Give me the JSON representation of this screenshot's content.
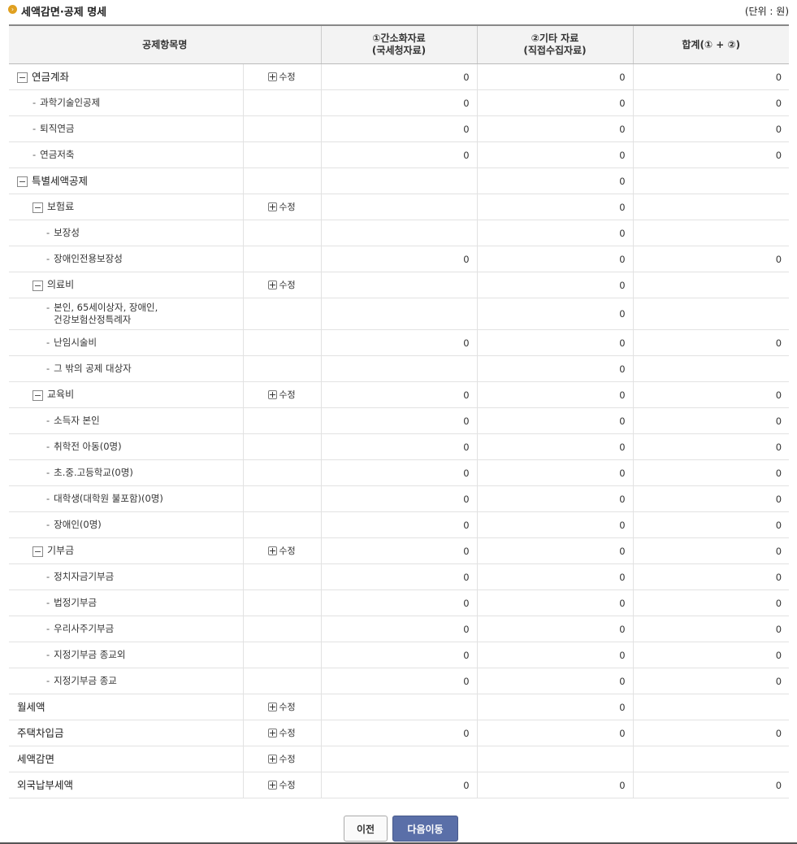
{
  "header": {
    "title": "세액감면·공제 명세",
    "unit": "(단위 : 원)"
  },
  "columns": {
    "item": "공제항목명",
    "col1": "①간소화자료\n(국세청자료)",
    "col2": "②기타 자료\n(직접수집자료)",
    "total": "합계(① + ②)"
  },
  "edit_label": "수정",
  "rows": [
    {
      "label": "연금계좌",
      "level": 0,
      "box": true,
      "edit": true,
      "c1": "0",
      "c2": "0",
      "t": "0"
    },
    {
      "label": "과학기술인공제",
      "level": 1,
      "box": false,
      "edit": false,
      "c1": "0",
      "c2": "0",
      "t": "0"
    },
    {
      "label": "퇴직연금",
      "level": 1,
      "box": false,
      "edit": false,
      "c1": "0",
      "c2": "0",
      "t": "0"
    },
    {
      "label": "연금저축",
      "level": 1,
      "box": false,
      "edit": false,
      "c1": "0",
      "c2": "0",
      "t": "0"
    },
    {
      "label": "특별세액공제",
      "level": 0,
      "box": true,
      "edit": false,
      "c1": "",
      "c2": "0",
      "t": ""
    },
    {
      "label": "보험료",
      "level": 1,
      "box": true,
      "edit": true,
      "c1": "",
      "c2": "0",
      "t": ""
    },
    {
      "label": "보장성",
      "level": 2,
      "box": false,
      "edit": false,
      "c1": "",
      "c2": "0",
      "t": ""
    },
    {
      "label": "장애인전용보장성",
      "level": 2,
      "box": false,
      "edit": false,
      "c1": "0",
      "c2": "0",
      "t": "0"
    },
    {
      "label": "의료비",
      "level": 1,
      "box": true,
      "edit": true,
      "c1": "",
      "c2": "0",
      "t": ""
    },
    {
      "label": "본인, 65세이상자, 장애인,\n건강보험산정특례자",
      "level": 2,
      "box": false,
      "edit": false,
      "c1": "",
      "c2": "0",
      "t": "",
      "tall": true
    },
    {
      "label": "난임시술비",
      "level": 2,
      "box": false,
      "edit": false,
      "c1": "0",
      "c2": "0",
      "t": "0"
    },
    {
      "label": "그 밖의 공제 대상자",
      "level": 2,
      "box": false,
      "edit": false,
      "c1": "",
      "c2": "0",
      "t": ""
    },
    {
      "label": "교육비",
      "level": 1,
      "box": true,
      "edit": true,
      "c1": "0",
      "c2": "0",
      "t": "0"
    },
    {
      "label": "소득자 본인",
      "level": 2,
      "box": false,
      "edit": false,
      "c1": "0",
      "c2": "0",
      "t": "0"
    },
    {
      "label": "취학전 아동(0명)",
      "level": 2,
      "box": false,
      "edit": false,
      "c1": "0",
      "c2": "0",
      "t": "0"
    },
    {
      "label": "초.중.고등학교(0명)",
      "level": 2,
      "box": false,
      "edit": false,
      "c1": "0",
      "c2": "0",
      "t": "0"
    },
    {
      "label": "대학생(대학원 불포함)(0명)",
      "level": 2,
      "box": false,
      "edit": false,
      "c1": "0",
      "c2": "0",
      "t": "0"
    },
    {
      "label": "장애인(0명)",
      "level": 2,
      "box": false,
      "edit": false,
      "c1": "0",
      "c2": "0",
      "t": "0"
    },
    {
      "label": "기부금",
      "level": 1,
      "box": true,
      "edit": true,
      "c1": "0",
      "c2": "0",
      "t": "0"
    },
    {
      "label": "정치자금기부금",
      "level": 2,
      "box": false,
      "edit": false,
      "c1": "0",
      "c2": "0",
      "t": "0"
    },
    {
      "label": "법정기부금",
      "level": 2,
      "box": false,
      "edit": false,
      "c1": "0",
      "c2": "0",
      "t": "0"
    },
    {
      "label": "우리사주기부금",
      "level": 2,
      "box": false,
      "edit": false,
      "c1": "0",
      "c2": "0",
      "t": "0"
    },
    {
      "label": "지정기부금 종교외",
      "level": 2,
      "box": false,
      "edit": false,
      "c1": "0",
      "c2": "0",
      "t": "0"
    },
    {
      "label": "지정기부금 종교",
      "level": 2,
      "box": false,
      "edit": false,
      "c1": "0",
      "c2": "0",
      "t": "0"
    },
    {
      "label": "월세액",
      "level": -1,
      "box": false,
      "edit": true,
      "c1": "",
      "c2": "0",
      "t": ""
    },
    {
      "label": "주택차입금",
      "level": -1,
      "box": false,
      "edit": true,
      "c1": "0",
      "c2": "0",
      "t": "0"
    },
    {
      "label": "세액감면",
      "level": -1,
      "box": false,
      "edit": true,
      "c1": "",
      "c2": "",
      "t": ""
    },
    {
      "label": "외국납부세액",
      "level": -1,
      "box": false,
      "edit": true,
      "c1": "0",
      "c2": "0",
      "t": "0"
    }
  ],
  "buttons": {
    "prev": "이전",
    "next": "다음이동"
  }
}
